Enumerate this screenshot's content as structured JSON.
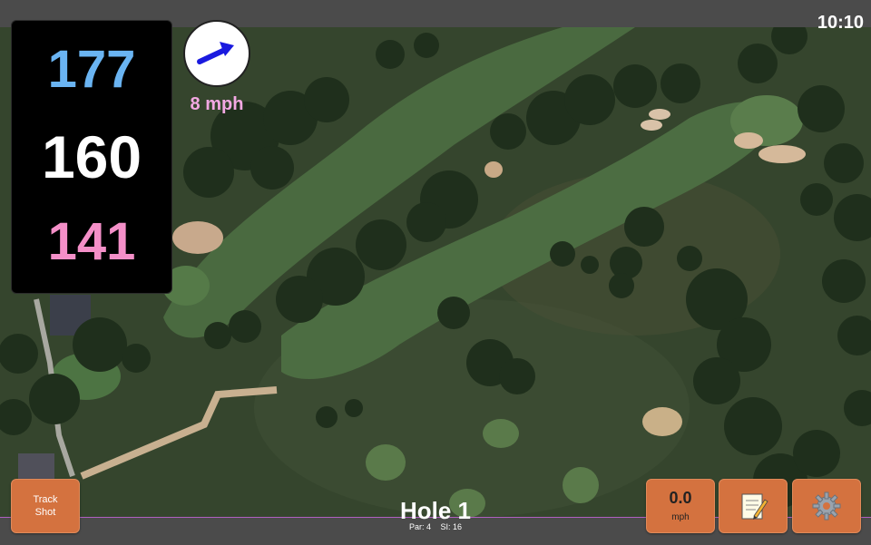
{
  "status": {
    "time": "10:10"
  },
  "distances": {
    "back": "177",
    "middle": "160",
    "front": "141"
  },
  "wind": {
    "speed": "8 mph"
  },
  "buttons": {
    "track_shot_line1": "Track",
    "track_shot_line2": "Shot",
    "speed_value": "0.0",
    "speed_unit": "mph"
  },
  "hole": {
    "title": "Hole 1",
    "par": "Par: 4",
    "si": "SI: 16"
  },
  "icons": {
    "wind_arrow": "arrow-icon",
    "notes": "notepad-icon",
    "settings": "gear-icon"
  },
  "colors": {
    "back_distance": "#6ab4f2",
    "middle_distance": "#ffffff",
    "front_distance": "#f48fc8",
    "wind_text": "#f3a8e3",
    "button": "#d4723f",
    "accent_border": "#b060c0"
  }
}
